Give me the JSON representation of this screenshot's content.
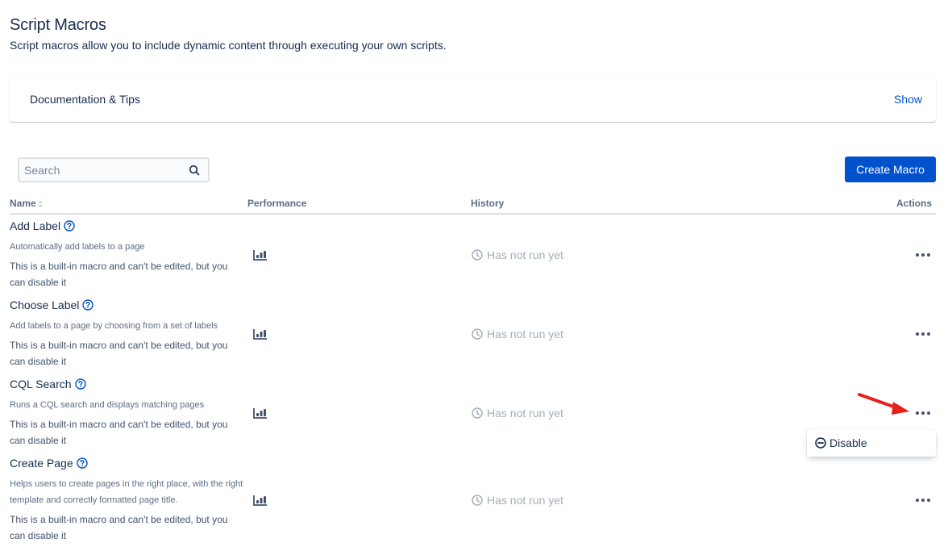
{
  "header": {
    "title": "Script Macros",
    "subtitle": "Script macros allow you to include dynamic content through executing your own scripts."
  },
  "docs_panel": {
    "title": "Documentation & Tips",
    "toggle_label": "Show"
  },
  "toolbar": {
    "search_placeholder": "Search",
    "search_value": "",
    "create_label": "Create Macro"
  },
  "table": {
    "columns": [
      "Name",
      "Performance",
      "History",
      "Actions"
    ],
    "rows": [
      {
        "name": "Add Label",
        "description": "Automatically add labels to a page",
        "note": "This is a built-in macro and can't be edited, but you can disable it",
        "history": "Has not run yet"
      },
      {
        "name": "Choose Label",
        "description": "Add labels to a page by choosing from a set of labels",
        "note": "This is a built-in macro and can't be edited, but you can disable it",
        "history": "Has not run yet"
      },
      {
        "name": "CQL Search",
        "description": "Runs a CQL search and displays matching pages",
        "note": "This is a built-in macro and can't be edited, but you can disable it",
        "history": "Has not run yet"
      },
      {
        "name": "Create Page",
        "description": "Helps users to create pages in the right place, with the right template and correctly formatted page title.",
        "note": "This is a built-in macro and can't be edited, but you can disable it",
        "history": "Has not run yet"
      }
    ]
  },
  "actions_menu": {
    "items": [
      {
        "label": "Disable",
        "icon": "minus-circle-icon"
      }
    ]
  },
  "colors": {
    "primary": "#0052cc",
    "text": "#172b4d",
    "subtle": "#5e6c84",
    "history": "#a5adba",
    "annotation_arrow": "#e8201a"
  }
}
